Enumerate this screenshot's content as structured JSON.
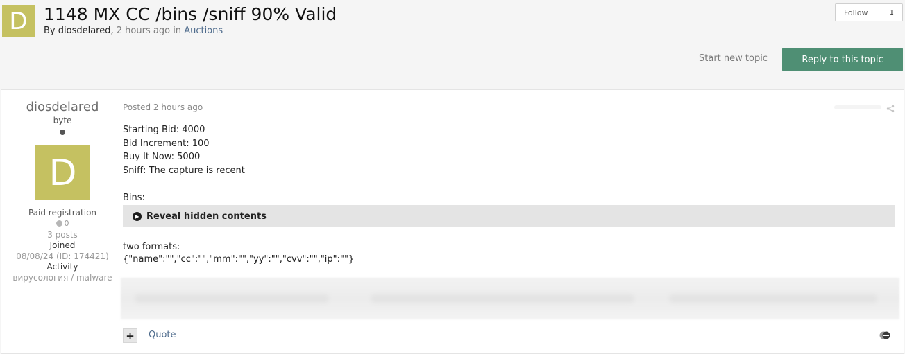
{
  "topic": {
    "avatar_letter": "D",
    "title": "1148 MX CC /bins /sniff 90% Valid",
    "by_label": "By",
    "author": "diosdelared",
    "comma": ",",
    "time": "2 hours ago",
    "in_label": "in",
    "forum": "Auctions"
  },
  "follow": {
    "label": "Follow",
    "count": "1"
  },
  "actions": {
    "start_new_topic": "Start new topic",
    "reply": "Reply to this topic"
  },
  "colors": {
    "accent": "#4f8f74",
    "avatar": "#c5c161",
    "link": "#4e6b8c"
  },
  "post": {
    "author": {
      "name": "diosdelared",
      "rank": "byte",
      "avatar_letter": "D",
      "group": "Paid registration",
      "reputation": "0",
      "posts": "3 posts",
      "joined_label": "Joined",
      "joined_value": "08/08/24 (ID: 174421)",
      "activity_label": "Activity",
      "activity_value": "вирусология / malware"
    },
    "date": "Posted 2 hours ago",
    "body_lines": [
      "Starting Bid: 4000",
      "Bid Increment: 100",
      "Buy It Now: 5000",
      "Sniff: The capture is recent",
      "",
      "Bins:"
    ],
    "reveal_label": "Reveal hidden contents",
    "formats_label": "two formats:",
    "formats_value": "{\"name\":\"\",\"cc\":\"\",\"mm\":\"\",\"yy\":\"\",\"cvv\":\"\",\"ip\":\"\"}",
    "plus_label": "+",
    "quote_label": "Quote"
  },
  "icons": {
    "share": "share-icon",
    "reveal": "chevron-right-circle-icon",
    "reaction": "reaction-icon",
    "online": "online-status-icon"
  }
}
